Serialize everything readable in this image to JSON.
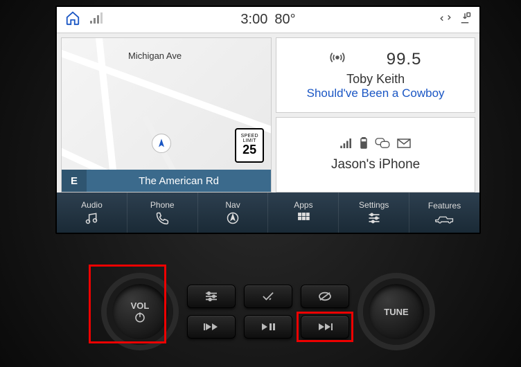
{
  "status": {
    "time": "3:00",
    "temp": "80°"
  },
  "map": {
    "street_label": "Michigan Ave",
    "speed_limit_label1": "SPEED",
    "speed_limit_label2": "LIMIT",
    "speed_limit_value": "25",
    "direction": "E",
    "road": "The American Rd"
  },
  "radio": {
    "frequency": "99.5",
    "artist": "Toby Keith",
    "song": "Should've Been a Cowboy"
  },
  "phone": {
    "device": "Jason's iPhone"
  },
  "nav": {
    "audio": "Audio",
    "phone": "Phone",
    "nav": "Nav",
    "apps": "Apps",
    "settings": "Settings",
    "features": "Features"
  },
  "hw": {
    "vol": "VOL",
    "tune": "TUNE"
  }
}
